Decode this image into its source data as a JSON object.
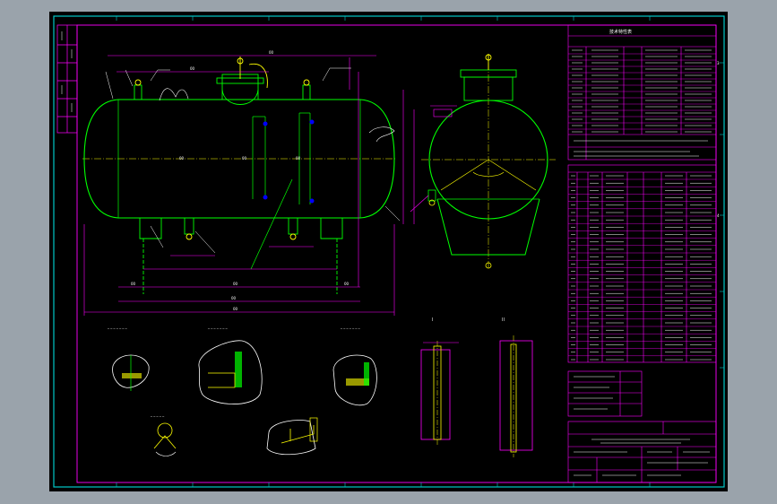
{
  "colors": {
    "background": "#9aa3ab",
    "sheet": "#000000",
    "frame": "#00c8c8",
    "border": "#ff00ff",
    "vessel": "#00ff00",
    "dims": "#ff00ff",
    "hatch": "#ffffff",
    "annotation": "#ffff00",
    "center": "#ffff00"
  },
  "title_block": {
    "header": "技术特性表",
    "rev_marks": [
      "a",
      "b",
      "c",
      "d",
      "e",
      "f",
      "g"
    ],
    "marks": [
      "3",
      "4"
    ]
  },
  "views": {
    "detail_I": "I",
    "detail_II": "II"
  }
}
